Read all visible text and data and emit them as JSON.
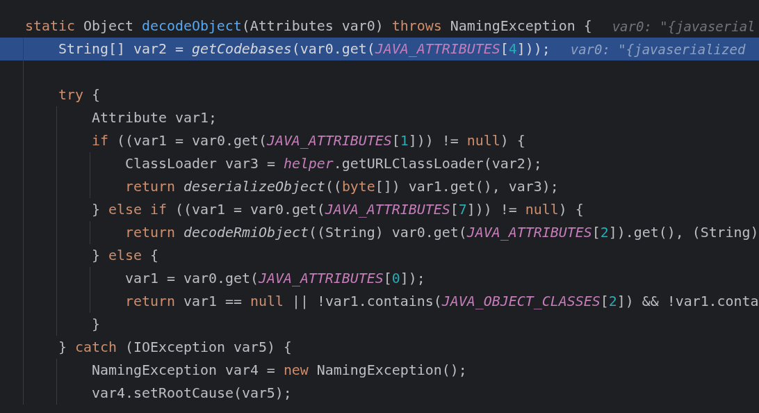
{
  "editor": {
    "lines": [
      {
        "kind": "code",
        "highlighted": false,
        "tokens": [
          {
            "text": "static",
            "kind": "keyword"
          },
          {
            "text": " Object ",
            "kind": "plain"
          },
          {
            "text": "decodeObject",
            "kind": "declaration"
          },
          {
            "text": "(Attributes var0) ",
            "kind": "plain"
          },
          {
            "text": "throws",
            "kind": "keyword"
          },
          {
            "text": " NamingException {",
            "kind": "plain"
          }
        ],
        "hint": "var0: \"{javaserial",
        "children": [
          {
            "kind": "code",
            "highlighted": true,
            "tokens": [
              {
                "text": "String[] var2 = ",
                "kind": "plain"
              },
              {
                "text": "getCodebases",
                "kind": "static-call"
              },
              {
                "text": "(var0.get(",
                "kind": "plain"
              },
              {
                "text": "JAVA_ATTRIBUTES",
                "kind": "static-field"
              },
              {
                "text": "[",
                "kind": "plain"
              },
              {
                "text": "4",
                "kind": "number"
              },
              {
                "text": "]));",
                "kind": "plain"
              }
            ],
            "hint": "var0: \"{javaserialized"
          },
          {
            "kind": "blank",
            "highlighted": false
          },
          {
            "kind": "code",
            "highlighted": false,
            "tokens": [
              {
                "text": "try",
                "kind": "keyword"
              },
              {
                "text": " {",
                "kind": "plain"
              }
            ],
            "children": [
              {
                "kind": "code",
                "highlighted": false,
                "tokens": [
                  {
                    "text": "Attribute var1;",
                    "kind": "plain"
                  }
                ]
              },
              {
                "kind": "code",
                "highlighted": false,
                "tokens": [
                  {
                    "text": "if",
                    "kind": "keyword"
                  },
                  {
                    "text": " ((var1 = var0.get(",
                    "kind": "plain"
                  },
                  {
                    "text": "JAVA_ATTRIBUTES",
                    "kind": "static-field"
                  },
                  {
                    "text": "[",
                    "kind": "plain"
                  },
                  {
                    "text": "1",
                    "kind": "number"
                  },
                  {
                    "text": "])) != ",
                    "kind": "plain"
                  },
                  {
                    "text": "null",
                    "kind": "keyword"
                  },
                  {
                    "text": ") {",
                    "kind": "plain"
                  }
                ],
                "children": [
                  {
                    "kind": "code",
                    "highlighted": false,
                    "tokens": [
                      {
                        "text": "ClassLoader var3 = ",
                        "kind": "plain"
                      },
                      {
                        "text": "helper",
                        "kind": "static-field"
                      },
                      {
                        "text": ".getURLClassLoader(var2);",
                        "kind": "plain"
                      }
                    ]
                  },
                  {
                    "kind": "code",
                    "highlighted": false,
                    "tokens": [
                      {
                        "text": "return ",
                        "kind": "keyword"
                      },
                      {
                        "text": "deserializeObject",
                        "kind": "static-call"
                      },
                      {
                        "text": "((",
                        "kind": "plain"
                      },
                      {
                        "text": "byte",
                        "kind": "keyword"
                      },
                      {
                        "text": "[]) var1.get(), var3);",
                        "kind": "plain"
                      }
                    ]
                  }
                ]
              },
              {
                "kind": "code",
                "highlighted": false,
                "tokens": [
                  {
                    "text": "} ",
                    "kind": "plain"
                  },
                  {
                    "text": "else if",
                    "kind": "keyword"
                  },
                  {
                    "text": " ((var1 = var0.get(",
                    "kind": "plain"
                  },
                  {
                    "text": "JAVA_ATTRIBUTES",
                    "kind": "static-field"
                  },
                  {
                    "text": "[",
                    "kind": "plain"
                  },
                  {
                    "text": "7",
                    "kind": "number"
                  },
                  {
                    "text": "])) != ",
                    "kind": "plain"
                  },
                  {
                    "text": "null",
                    "kind": "keyword"
                  },
                  {
                    "text": ") {",
                    "kind": "plain"
                  }
                ],
                "children": [
                  {
                    "kind": "code",
                    "highlighted": false,
                    "tokens": [
                      {
                        "text": "return ",
                        "kind": "keyword"
                      },
                      {
                        "text": "decodeRmiObject",
                        "kind": "static-call"
                      },
                      {
                        "text": "((String) var0.get(",
                        "kind": "plain"
                      },
                      {
                        "text": "JAVA_ATTRIBUTES",
                        "kind": "static-field"
                      },
                      {
                        "text": "[",
                        "kind": "plain"
                      },
                      {
                        "text": "2",
                        "kind": "number"
                      },
                      {
                        "text": "]).get(), (String)",
                        "kind": "plain"
                      }
                    ]
                  }
                ]
              },
              {
                "kind": "code",
                "highlighted": false,
                "tokens": [
                  {
                    "text": "} ",
                    "kind": "plain"
                  },
                  {
                    "text": "else",
                    "kind": "keyword"
                  },
                  {
                    "text": " {",
                    "kind": "plain"
                  }
                ],
                "children": [
                  {
                    "kind": "code",
                    "highlighted": false,
                    "tokens": [
                      {
                        "text": "var1 = var0.get(",
                        "kind": "plain"
                      },
                      {
                        "text": "JAVA_ATTRIBUTES",
                        "kind": "static-field"
                      },
                      {
                        "text": "[",
                        "kind": "plain"
                      },
                      {
                        "text": "0",
                        "kind": "number"
                      },
                      {
                        "text": "]);",
                        "kind": "plain"
                      }
                    ]
                  },
                  {
                    "kind": "code",
                    "highlighted": false,
                    "tokens": [
                      {
                        "text": "return",
                        "kind": "keyword"
                      },
                      {
                        "text": " var1 == ",
                        "kind": "plain"
                      },
                      {
                        "text": "null",
                        "kind": "keyword"
                      },
                      {
                        "text": " || !var1.contains(",
                        "kind": "plain"
                      },
                      {
                        "text": "JAVA_OBJECT_CLASSES",
                        "kind": "static-field"
                      },
                      {
                        "text": "[",
                        "kind": "plain"
                      },
                      {
                        "text": "2",
                        "kind": "number"
                      },
                      {
                        "text": "]) && !var1.conta",
                        "kind": "plain"
                      }
                    ]
                  }
                ]
              },
              {
                "kind": "code",
                "highlighted": false,
                "tokens": [
                  {
                    "text": "}",
                    "kind": "plain"
                  }
                ]
              }
            ]
          },
          {
            "kind": "code",
            "highlighted": false,
            "tokens": [
              {
                "text": "} ",
                "kind": "plain"
              },
              {
                "text": "catch",
                "kind": "keyword"
              },
              {
                "text": " (IOException var5) {",
                "kind": "plain"
              }
            ],
            "children": [
              {
                "kind": "code",
                "highlighted": false,
                "tokens": [
                  {
                    "text": "NamingException var4 = ",
                    "kind": "plain"
                  },
                  {
                    "text": "new",
                    "kind": "keyword"
                  },
                  {
                    "text": " NamingException();",
                    "kind": "plain"
                  }
                ]
              },
              {
                "kind": "code",
                "highlighted": false,
                "tokens": [
                  {
                    "text": "var4.setRootCause(var5);",
                    "kind": "plain"
                  }
                ]
              }
            ]
          }
        ]
      }
    ]
  }
}
